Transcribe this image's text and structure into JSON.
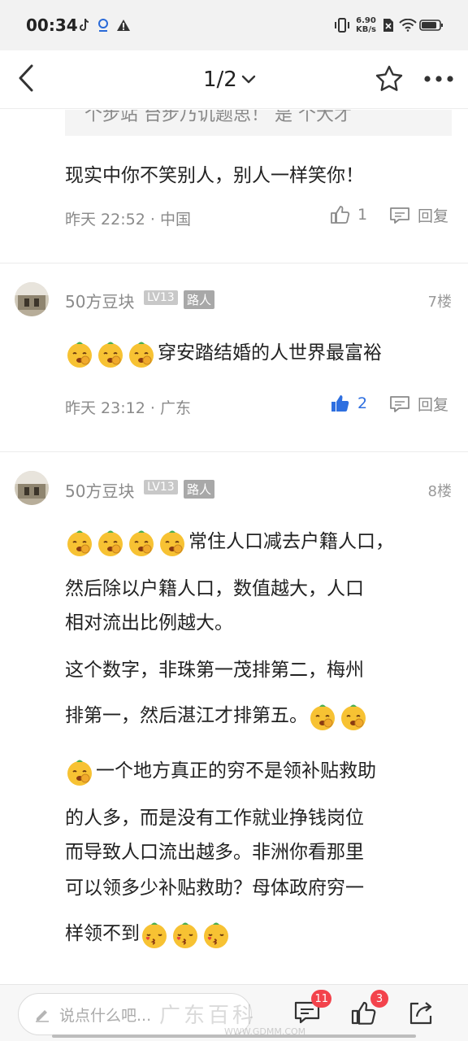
{
  "status_bar": {
    "time": "00:34",
    "net_speed_value": "6.90",
    "net_speed_unit": "KB/s",
    "icons": [
      "tiktok-icon",
      "baby-icon",
      "warning-icon",
      "vibrate-icon",
      "no-sim-icon",
      "wifi-icon",
      "battery-icon"
    ]
  },
  "nav": {
    "page_indicator": "1/2",
    "icons": [
      "back-arrow-icon",
      "chevron-down-icon",
      "star-icon",
      "more-icon"
    ]
  },
  "quoted_text": "个步站  台步乃讥题思！ 是  个大才",
  "comments": [
    {
      "text": "现实中你不笑别人，别人一样笑你！",
      "time": "昨天 22:52",
      "location": "中国",
      "likes": "1",
      "reply_label": "回复"
    },
    {
      "username": "50方豆块",
      "level": "LV13",
      "role": "路人",
      "floor": "7楼",
      "text": "穿安踏结婚的人世界最富裕",
      "time": "昨天 23:12",
      "location": "广东",
      "likes": "2",
      "liked": true,
      "reply_label": "回复"
    },
    {
      "username": "50方豆块",
      "level": "LV13",
      "role": "路人",
      "floor": "8楼",
      "lines": [
        "常住人口减去户籍人口，",
        "然后除以户籍人口，数值越大，人口",
        "相对流出比例越大。",
        "这个数字，非珠第一茂排第二，梅州",
        "排第一，然后湛江才排第五。",
        "一个地方真正的穷不是领补贴救助",
        "的人多，而是没有工作就业挣钱岗位",
        "而导致人口流出越多。非洲你看那里",
        "可以领多少补贴救助？母体政府穷一",
        "样领不到"
      ]
    }
  ],
  "bottom_bar": {
    "placeholder": "说点什么吧...",
    "comments_count": "11",
    "likes_count": "3"
  },
  "watermark": {
    "text": "广东百科",
    "url": "WWW.GDMM.COM"
  },
  "colors": {
    "accent_blue": "#2e6fe0",
    "badge_red": "#f3434c",
    "meta_gray": "#8a8a8a"
  }
}
